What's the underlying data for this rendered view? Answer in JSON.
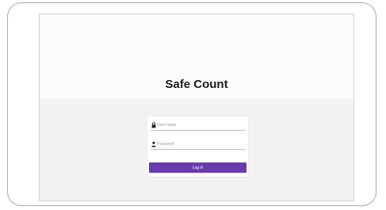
{
  "app": {
    "title": "Safe Count"
  },
  "login": {
    "username_placeholder": "User name",
    "username_value": "",
    "username_icon": "lock-icon",
    "password_placeholder": "Password",
    "password_value": "",
    "password_icon": "user-icon",
    "button_label": "Log in",
    "button_color": "#6a3ab0"
  }
}
